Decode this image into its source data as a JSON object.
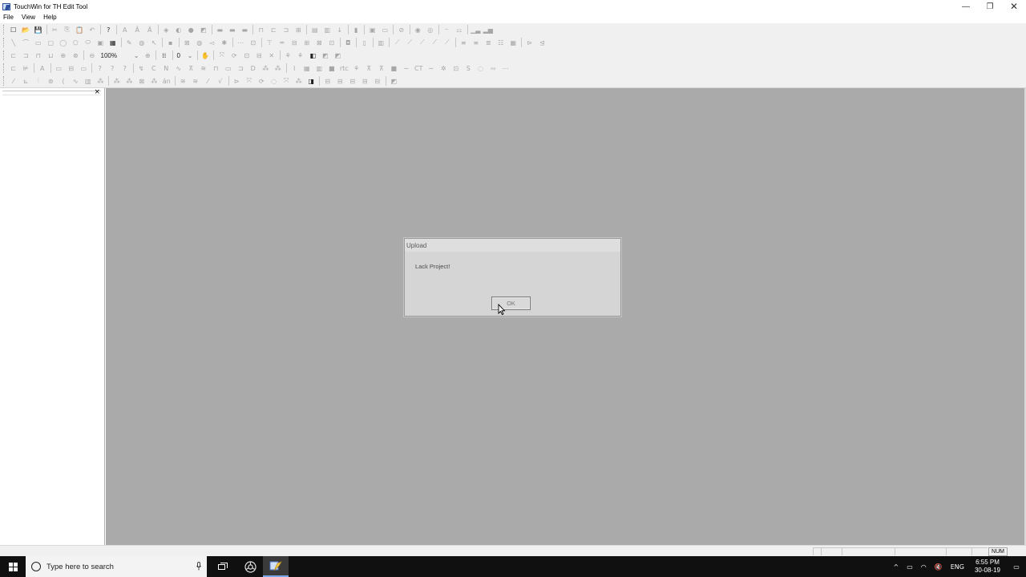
{
  "window": {
    "title": "TouchWin for TH Edit Tool",
    "controls": {
      "minimize": "—",
      "maximize": "❐",
      "close": "✕"
    }
  },
  "menu": [
    "File",
    "View",
    "Help"
  ],
  "toolbar": {
    "zoom_value": "100%",
    "number_value": "0",
    "dropdown_arrow": "⌄",
    "row1": [
      {
        "g": "☐",
        "t": "dark"
      },
      {
        "g": "📂",
        "t": "dark"
      },
      {
        "g": "💾",
        "t": "dark"
      },
      {
        "sep": true
      },
      {
        "g": "✂",
        "t": "dim"
      },
      {
        "g": "⎘",
        "t": "dim"
      },
      {
        "g": "📋",
        "t": "dim"
      },
      {
        "g": "↶",
        "t": "dim"
      },
      {
        "sep": true
      },
      {
        "g": "?",
        "t": "dark"
      },
      {
        "sep": true
      },
      {
        "g": "A",
        "t": "dim"
      },
      {
        "g": "Â",
        "t": "dim"
      },
      {
        "g": "Ä",
        "t": "dim"
      },
      {
        "sep": true
      },
      {
        "g": "◈",
        "t": "dim"
      },
      {
        "g": "◐",
        "t": "dim"
      },
      {
        "g": "●",
        "t": "dim"
      },
      {
        "g": "◩",
        "t": "dim"
      },
      {
        "sep": true
      },
      {
        "g": "▬",
        "t": "dim"
      },
      {
        "g": "▬",
        "t": "dim"
      },
      {
        "g": "▬",
        "t": "dim"
      },
      {
        "sep": true
      },
      {
        "g": "⊓",
        "t": "dim"
      },
      {
        "g": "⊏",
        "t": "dim"
      },
      {
        "g": "⊐",
        "t": "dim"
      },
      {
        "g": "⊞",
        "t": "dim"
      },
      {
        "sep": true
      },
      {
        "g": "▤",
        "t": "dim"
      },
      {
        "g": "▥",
        "t": "dim"
      },
      {
        "g": "↓",
        "t": "dim"
      },
      {
        "sep": true
      },
      {
        "g": "▮",
        "t": "dim"
      },
      {
        "sep": true
      },
      {
        "g": "▣",
        "t": "dim"
      },
      {
        "g": "▭",
        "t": "dim"
      },
      {
        "sep": true
      },
      {
        "g": "⊘",
        "t": "dim"
      },
      {
        "sep": true
      },
      {
        "g": "◉",
        "t": "dim"
      },
      {
        "g": "◎",
        "t": "dim"
      },
      {
        "sep": true
      },
      {
        "g": "⎯",
        "t": "dim"
      },
      {
        "g": "⚏",
        "t": "dim"
      },
      {
        "sep": true
      },
      {
        "g": "▁▃",
        "t": "dim"
      },
      {
        "g": "▂▅",
        "t": "dim"
      }
    ],
    "row2": [
      {
        "g": "╲",
        "t": "dim"
      },
      {
        "g": "⌒",
        "t": "dim"
      },
      {
        "g": "▭",
        "t": "dim"
      },
      {
        "g": "▢",
        "t": "dim"
      },
      {
        "g": "◯",
        "t": "dim"
      },
      {
        "g": "⬠",
        "t": "dim"
      },
      {
        "g": "⬭",
        "t": "dim"
      },
      {
        "g": "▣",
        "t": "dim"
      },
      {
        "g": "▦",
        "t": "dark"
      },
      {
        "sep": true
      },
      {
        "g": "✎",
        "t": "dim"
      },
      {
        "g": "◍",
        "t": "dim"
      },
      {
        "g": "↖",
        "t": "dim"
      },
      {
        "sep": true
      },
      {
        "g": "▪",
        "t": "dim"
      },
      {
        "sep": true
      },
      {
        "g": "⊠",
        "t": "dim"
      },
      {
        "g": "◍",
        "t": "dim"
      },
      {
        "g": "◅",
        "t": "dim"
      },
      {
        "g": "✱",
        "t": "dim"
      },
      {
        "sep": true
      },
      {
        "g": "⋯",
        "t": "dim"
      },
      {
        "g": "⊡",
        "t": "dim"
      },
      {
        "sep": true
      },
      {
        "g": "⊤",
        "t": "dim"
      },
      {
        "g": "═",
        "t": "dim"
      },
      {
        "g": "⊟",
        "t": "dim"
      },
      {
        "g": "⊞",
        "t": "dim"
      },
      {
        "g": "⊠",
        "t": "dim"
      },
      {
        "g": "⊡",
        "t": "dim"
      },
      {
        "sep": true
      },
      {
        "g": "◘",
        "t": "dim"
      },
      {
        "sep": true
      },
      {
        "g": "▯",
        "t": "dim"
      },
      {
        "sep": true
      },
      {
        "g": "▥",
        "t": "dim"
      },
      {
        "sep": true
      },
      {
        "g": "⟋",
        "t": "dim"
      },
      {
        "g": "⟋",
        "t": "dim"
      },
      {
        "g": "⟋",
        "t": "dim"
      },
      {
        "g": "⟋",
        "t": "dim"
      },
      {
        "g": "⟋",
        "t": "dim"
      },
      {
        "sep": true
      },
      {
        "g": "≡",
        "t": "dim"
      },
      {
        "g": "≡",
        "t": "dim"
      },
      {
        "g": "≣",
        "t": "dim"
      },
      {
        "g": "☷",
        "t": "dim"
      },
      {
        "g": "▦",
        "t": "dim"
      },
      {
        "sep": true
      },
      {
        "g": "⊳",
        "t": "dim"
      },
      {
        "g": "⊴",
        "t": "dim"
      }
    ],
    "row3a": [
      {
        "g": "⊏",
        "t": "dim"
      },
      {
        "g": "⊐",
        "t": "dim"
      },
      {
        "g": "⊓",
        "t": "dim"
      },
      {
        "g": "⊔",
        "t": "dim"
      },
      {
        "g": "⊕",
        "t": "dim"
      },
      {
        "g": "⊗",
        "t": "dim"
      },
      {
        "sep": true
      }
    ],
    "row3b": [
      {
        "g": "⊕",
        "t": "dim"
      },
      {
        "sep": true
      },
      {
        "g": "⁞⁞",
        "t": "dark"
      },
      {
        "sep": true
      }
    ],
    "row3c": [
      {
        "sep": true
      },
      {
        "g": "✋",
        "t": "dim"
      },
      {
        "sep": true
      },
      {
        "g": "⤧",
        "t": "dim"
      },
      {
        "g": "⟳",
        "t": "dim"
      },
      {
        "g": "⊡",
        "t": "dim"
      },
      {
        "g": "⊟",
        "t": "dim"
      },
      {
        "g": "✕",
        "t": "dim"
      },
      {
        "sep": true
      },
      {
        "g": "⚘",
        "t": "dim"
      },
      {
        "g": "⚘",
        "t": "dim"
      },
      {
        "g": "◧",
        "t": "dark"
      },
      {
        "g": "◩",
        "t": "dim"
      },
      {
        "g": "◩",
        "t": "dim"
      }
    ],
    "row4": [
      {
        "g": "⊏",
        "t": "dim"
      },
      {
        "g": "⊭",
        "t": "dim"
      },
      {
        "sep": true
      },
      {
        "g": "A",
        "t": "dim"
      },
      {
        "sep": true
      },
      {
        "g": "▭",
        "t": "dim"
      },
      {
        "g": "⊟",
        "t": "dim"
      },
      {
        "g": "▭",
        "t": "dim"
      },
      {
        "sep": true
      },
      {
        "g": "?",
        "t": "dim"
      },
      {
        "g": "?",
        "t": "dim"
      },
      {
        "g": "?",
        "t": "dim"
      },
      {
        "sep": true
      },
      {
        "g": "↯",
        "t": "dim"
      },
      {
        "g": "C",
        "t": "dim"
      },
      {
        "g": "N",
        "t": "dim"
      },
      {
        "g": "∿",
        "t": "dim"
      },
      {
        "g": "⊼",
        "t": "dim"
      },
      {
        "g": "≋",
        "t": "dim"
      },
      {
        "g": "⊓",
        "t": "dim"
      },
      {
        "g": "▭",
        "t": "dim"
      },
      {
        "g": "⊐",
        "t": "dim"
      },
      {
        "g": "D",
        "t": "dim"
      },
      {
        "g": "⁂",
        "t": "dim"
      },
      {
        "g": "⁂",
        "t": "dim"
      },
      {
        "sep": true
      },
      {
        "g": "⌇",
        "t": "dim"
      },
      {
        "g": "▦",
        "t": "dim"
      },
      {
        "g": "▥",
        "t": "dim"
      },
      {
        "g": "■",
        "t": "dim"
      },
      {
        "g": "rtc",
        "t": "dim"
      },
      {
        "g": "⚘",
        "t": "dim"
      },
      {
        "g": "⊼",
        "t": "dim"
      },
      {
        "g": "⊼",
        "t": "dim"
      },
      {
        "g": "■",
        "t": "dim"
      },
      {
        "g": "∼",
        "t": "dim"
      },
      {
        "g": "CT",
        "t": "dim"
      },
      {
        "g": "∼",
        "t": "dim"
      },
      {
        "g": "✲",
        "t": "dim"
      },
      {
        "g": "⊡",
        "t": "dim"
      },
      {
        "g": "S",
        "t": "dim"
      },
      {
        "g": "◌",
        "t": "dim"
      },
      {
        "g": "∾",
        "t": "dim"
      },
      {
        "g": "⋯",
        "t": "dim"
      }
    ],
    "row5": [
      {
        "g": "⁄",
        "t": "dim"
      },
      {
        "g": "⊾",
        "t": "dim"
      },
      {
        "g": "⦙",
        "t": "dim"
      },
      {
        "g": "⊚",
        "t": "dim"
      },
      {
        "g": "⟨",
        "t": "dim"
      },
      {
        "g": "∿",
        "t": "dim"
      },
      {
        "g": "▥",
        "t": "dim"
      },
      {
        "g": "⁂",
        "t": "dim"
      },
      {
        "sep": true
      },
      {
        "g": "⁂",
        "t": "dim"
      },
      {
        "g": "⁂",
        "t": "dim"
      },
      {
        "g": "⊠",
        "t": "dim"
      },
      {
        "g": "⁂",
        "t": "dim"
      },
      {
        "g": "án",
        "t": "dim"
      },
      {
        "sep": true
      },
      {
        "g": "≋",
        "t": "dim"
      },
      {
        "g": "≋",
        "t": "dim"
      },
      {
        "g": "⁄",
        "t": "dim"
      },
      {
        "g": "√",
        "t": "dim"
      },
      {
        "sep": true
      },
      {
        "g": "⊳",
        "t": "dim"
      },
      {
        "g": "⤧",
        "t": "dim"
      },
      {
        "g": "⟳",
        "t": "dim"
      },
      {
        "g": "◌",
        "t": "dim"
      },
      {
        "g": "⤧",
        "t": "dim"
      },
      {
        "g": "⁂",
        "t": "dim"
      },
      {
        "g": "◨",
        "t": "dark"
      },
      {
        "sep": true
      },
      {
        "g": "⊟",
        "t": "dim"
      },
      {
        "g": "⊟",
        "t": "dim"
      },
      {
        "g": "⊟",
        "t": "dim"
      },
      {
        "g": "⊟",
        "t": "dim"
      },
      {
        "g": "⊟",
        "t": "dim"
      },
      {
        "sep": true
      },
      {
        "g": "◩",
        "t": "dim"
      }
    ]
  },
  "left_panel": {
    "close_glyph": "×"
  },
  "dialog": {
    "title": "Upload",
    "message": "Lack Project!",
    "ok_label": "OK"
  },
  "statusbar": {
    "num": "NUM"
  },
  "taskbar": {
    "search_placeholder": "Type here to search",
    "tray_chevron": "^",
    "tray_network": "▭",
    "tray_wifi": "◠",
    "tray_volume": "🔇",
    "tray_lang": "ENG",
    "time": "6:55 PM",
    "date": "30-08-19",
    "notif": "▭"
  }
}
